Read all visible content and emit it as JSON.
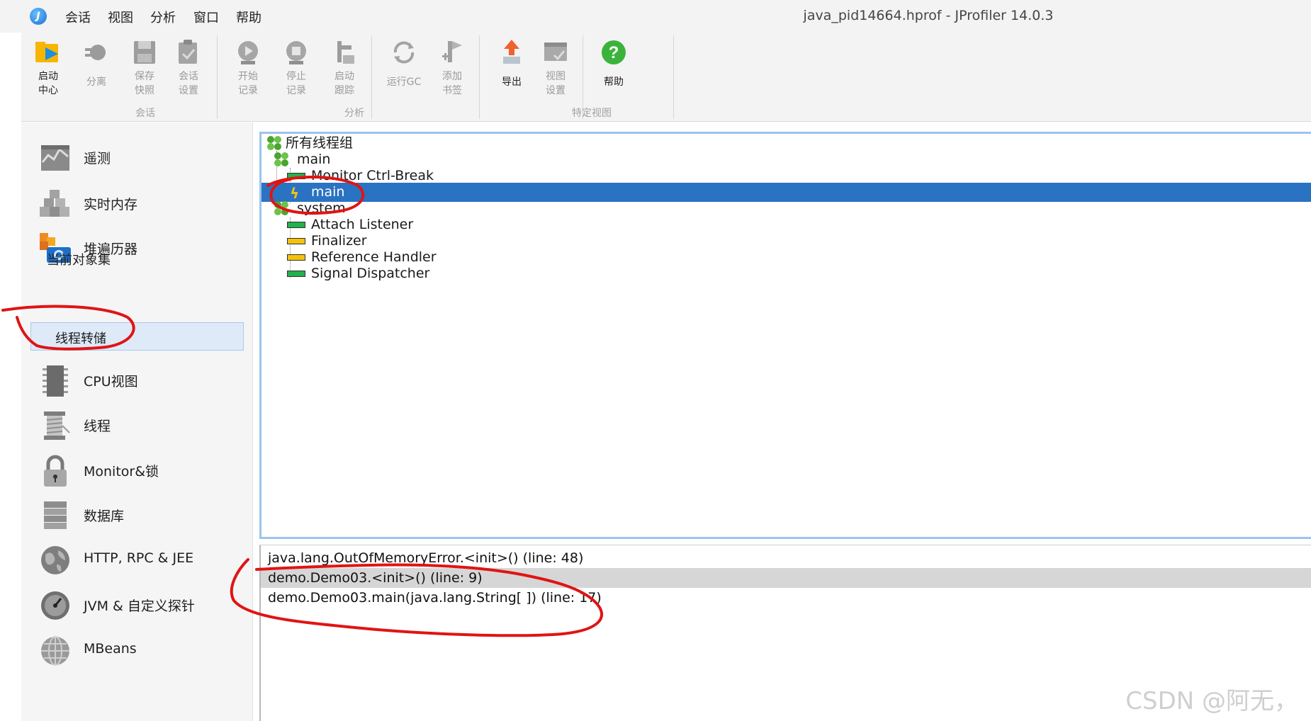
{
  "window": {
    "title": "java_pid14664.hprof - JProfiler 14.0.3"
  },
  "menu": [
    "会话",
    "视图",
    "分析",
    "窗口",
    "帮助"
  ],
  "toolbar": {
    "buttons": [
      {
        "label": "启动\n中心",
        "icon": "start-center-icon",
        "enabled": true
      },
      {
        "label": "分离",
        "icon": "detach-icon",
        "enabled": false
      },
      {
        "label": "保存\n快照",
        "icon": "save-snapshot-icon",
        "enabled": false
      },
      {
        "label": "会话\n设置",
        "icon": "session-settings-icon",
        "enabled": false
      },
      {
        "label": "开始\n记录",
        "icon": "start-recording-icon",
        "enabled": false
      },
      {
        "label": "停止\n记录",
        "icon": "stop-recording-icon",
        "enabled": false
      },
      {
        "label": "启动\n跟踪",
        "icon": "start-tracking-icon",
        "enabled": false
      },
      {
        "label": "运行GC",
        "icon": "run-gc-icon",
        "enabled": false
      },
      {
        "label": "添加\n书签",
        "icon": "add-bookmark-icon",
        "enabled": false
      },
      {
        "label": "导出",
        "icon": "export-icon",
        "enabled": true
      },
      {
        "label": "视图\n设置",
        "icon": "view-settings-icon",
        "enabled": false
      },
      {
        "label": "帮助",
        "icon": "help-icon",
        "enabled": true
      }
    ],
    "groups": [
      "会话",
      "分析",
      "特定视图"
    ]
  },
  "nav": {
    "items": [
      {
        "label": "遥测",
        "icon": "telemetry-icon"
      },
      {
        "label": "实时内存",
        "icon": "live-memory-icon"
      },
      {
        "label": "堆遍历器",
        "icon": "heap-walker-icon"
      },
      {
        "label": "CPU视图",
        "icon": "cpu-views-icon"
      },
      {
        "label": "线程",
        "icon": "threads-icon"
      },
      {
        "label": "Monitor&锁",
        "icon": "monitor-lock-icon"
      },
      {
        "label": "数据库",
        "icon": "database-icon"
      },
      {
        "label": "HTTP, RPC & JEE",
        "icon": "http-rpc-icon"
      },
      {
        "label": "JVM & 自定义探针",
        "icon": "jvm-probes-icon"
      },
      {
        "label": "MBeans",
        "icon": "mbeans-icon"
      }
    ],
    "sub_items": [
      "当前对象集",
      "线程转储"
    ],
    "selected_sub_item": "线程转储"
  },
  "thread_tree": {
    "root": "所有线程组",
    "groups": [
      {
        "name": "main",
        "threads": [
          {
            "name": "Monitor Ctrl-Break",
            "state": "running",
            "color": "#22b14c"
          },
          {
            "name": "main",
            "state": "current",
            "color": "#f4c20d",
            "selected": true
          }
        ]
      },
      {
        "name": "system",
        "threads": [
          {
            "name": "Attach Listener",
            "state": "running",
            "color": "#22b14c"
          },
          {
            "name": "Finalizer",
            "state": "waiting",
            "color": "#f4c20d"
          },
          {
            "name": "Reference Handler",
            "state": "waiting",
            "color": "#f4c20d"
          },
          {
            "name": "Signal Dispatcher",
            "state": "running",
            "color": "#22b14c"
          }
        ]
      }
    ]
  },
  "stack_trace": [
    "java.lang.OutOfMemoryError.<init>() (line: 48)",
    "demo.Demo03.<init>() (line: 9)",
    "demo.Demo03.main(java.lang.String[ ]) (line: 17)"
  ],
  "colors": {
    "selection": "#2a73c2",
    "annotation": "#e01414",
    "running": "#22b14c",
    "waiting": "#f4c20d"
  },
  "watermark": "CSDN @阿无，"
}
